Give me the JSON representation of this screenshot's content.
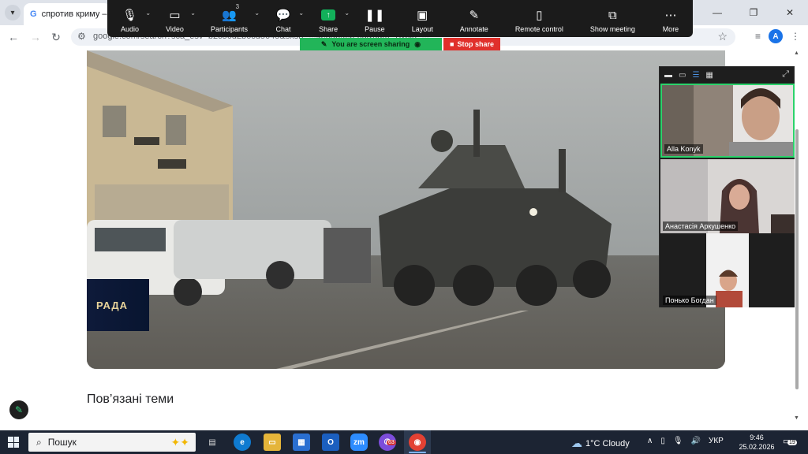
{
  "browser": {
    "tab_title": "спротив криму – По",
    "url": "google.com/search?sca_esv=b2c56d2b6cd5645&sxsrf=...4e5ab9f426d&udm=7&bih=...",
    "profile_initial": "A"
  },
  "zoom": {
    "toolbar": [
      {
        "label": "Audio",
        "icon": "microphone-icon"
      },
      {
        "label": "Video",
        "icon": "video-camera-icon"
      },
      {
        "label": "Participants",
        "icon": "participants-icon",
        "count": "3"
      },
      {
        "label": "Chat",
        "icon": "chat-icon"
      },
      {
        "label": "Share",
        "icon": "share-screen-icon"
      },
      {
        "label": "Pause",
        "icon": "pause-icon"
      },
      {
        "label": "Layout",
        "icon": "layout-icon"
      },
      {
        "label": "Annotate",
        "icon": "pencil-icon"
      },
      {
        "label": "Remote control",
        "icon": "mouse-icon"
      },
      {
        "label": "Show meeting",
        "icon": "window-icon"
      },
      {
        "label": "More",
        "icon": "more-icon"
      }
    ],
    "sharing_status": "You are screen sharing",
    "stop_share_label": "Stop share",
    "participants": [
      {
        "name": "Alla Konyk",
        "active_speaker": true
      },
      {
        "name": "Анастасія Аркушенко",
        "active_speaker": false
      },
      {
        "name": "Понько Богдан",
        "active_speaker": false
      }
    ]
  },
  "page": {
    "video_overlay_text": "РАДА",
    "related_topics_heading": "Пов’язані теми"
  },
  "taskbar": {
    "search_placeholder": "Пошук",
    "weather": "1°C  Cloudy",
    "language": "УКР",
    "time": "9:46",
    "date": "25.02.2026",
    "viber_badge": "63",
    "notification_count": "19"
  },
  "colors": {
    "zoom_toolbar": "#1b1b1b",
    "sharing_green": "#22b559",
    "stop_red": "#e0302b",
    "active_speaker_border": "#2bd36b",
    "taskbar": "#1c2433"
  }
}
